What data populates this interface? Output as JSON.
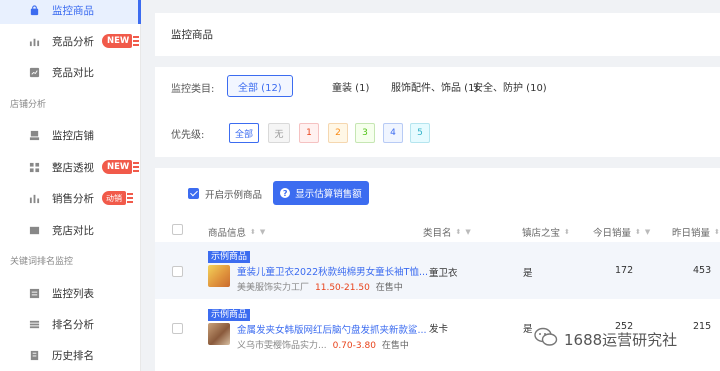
{
  "sidebar": {
    "items": [
      {
        "label": "监控商品",
        "icon": "bag-icon",
        "active": true
      },
      {
        "label": "竞品分析",
        "icon": "bar-chart-icon",
        "badge": "NEW"
      },
      {
        "label": "竞品对比",
        "icon": "compare-icon"
      },
      {
        "label": "监控店铺",
        "icon": "shop-icon"
      },
      {
        "label": "整店透视",
        "icon": "grid-icon",
        "badge": "NEW"
      },
      {
        "label": "销售分析",
        "icon": "sales-chart-icon",
        "badge": "动销"
      },
      {
        "label": "竞店对比",
        "icon": "shop-compare-icon"
      },
      {
        "label": "监控列表",
        "icon": "list-icon"
      },
      {
        "label": "排名分析",
        "icon": "rank-icon"
      },
      {
        "label": "历史排名",
        "icon": "history-icon"
      }
    ],
    "groups": [
      "店铺分析",
      "关键词排名监控"
    ]
  },
  "title_panel": {
    "title": "监控商品"
  },
  "filter": {
    "category_label": "监控类目:",
    "categories": [
      "全部 (12)",
      "童装 (1)",
      "服饰配件、饰品 (1)",
      "安全、防护 (10)"
    ],
    "priority_label": "优先级:",
    "priorities": [
      "全部",
      "无",
      "1",
      "2",
      "3",
      "4",
      "5"
    ]
  },
  "table": {
    "show_sample_label": "开启示例商品",
    "show_sales_button": "显示估算销售额",
    "headers": [
      "商品信息",
      "类目名",
      "镇店之宝",
      "今日销量",
      "昨日销量"
    ],
    "rows": [
      {
        "tag": "示例商品",
        "name": "童装儿童卫衣2022秋款纯棉男女童长袖T恤...",
        "shop": "美美服饰实力工厂",
        "price": "11.50-21.50",
        "status": "在售中",
        "category": "童卫衣",
        "treasure": "是",
        "today": "172",
        "yesterday": "453"
      },
      {
        "tag": "示例商品",
        "name": "金属发夹女韩版网红后脑勺盘发抓夹新款鲨...",
        "shop": "义乌市雯樱饰品实力...",
        "price": "0.70-3.80",
        "status": "在售中",
        "category": "发卡",
        "treasure": "是",
        "today": "252",
        "yesterday": "215"
      }
    ]
  },
  "watermark": "1688运营研究社",
  "colors": {
    "accent": "#3c6cf0",
    "badge": "#f15a4a",
    "price": "#e8431b"
  }
}
